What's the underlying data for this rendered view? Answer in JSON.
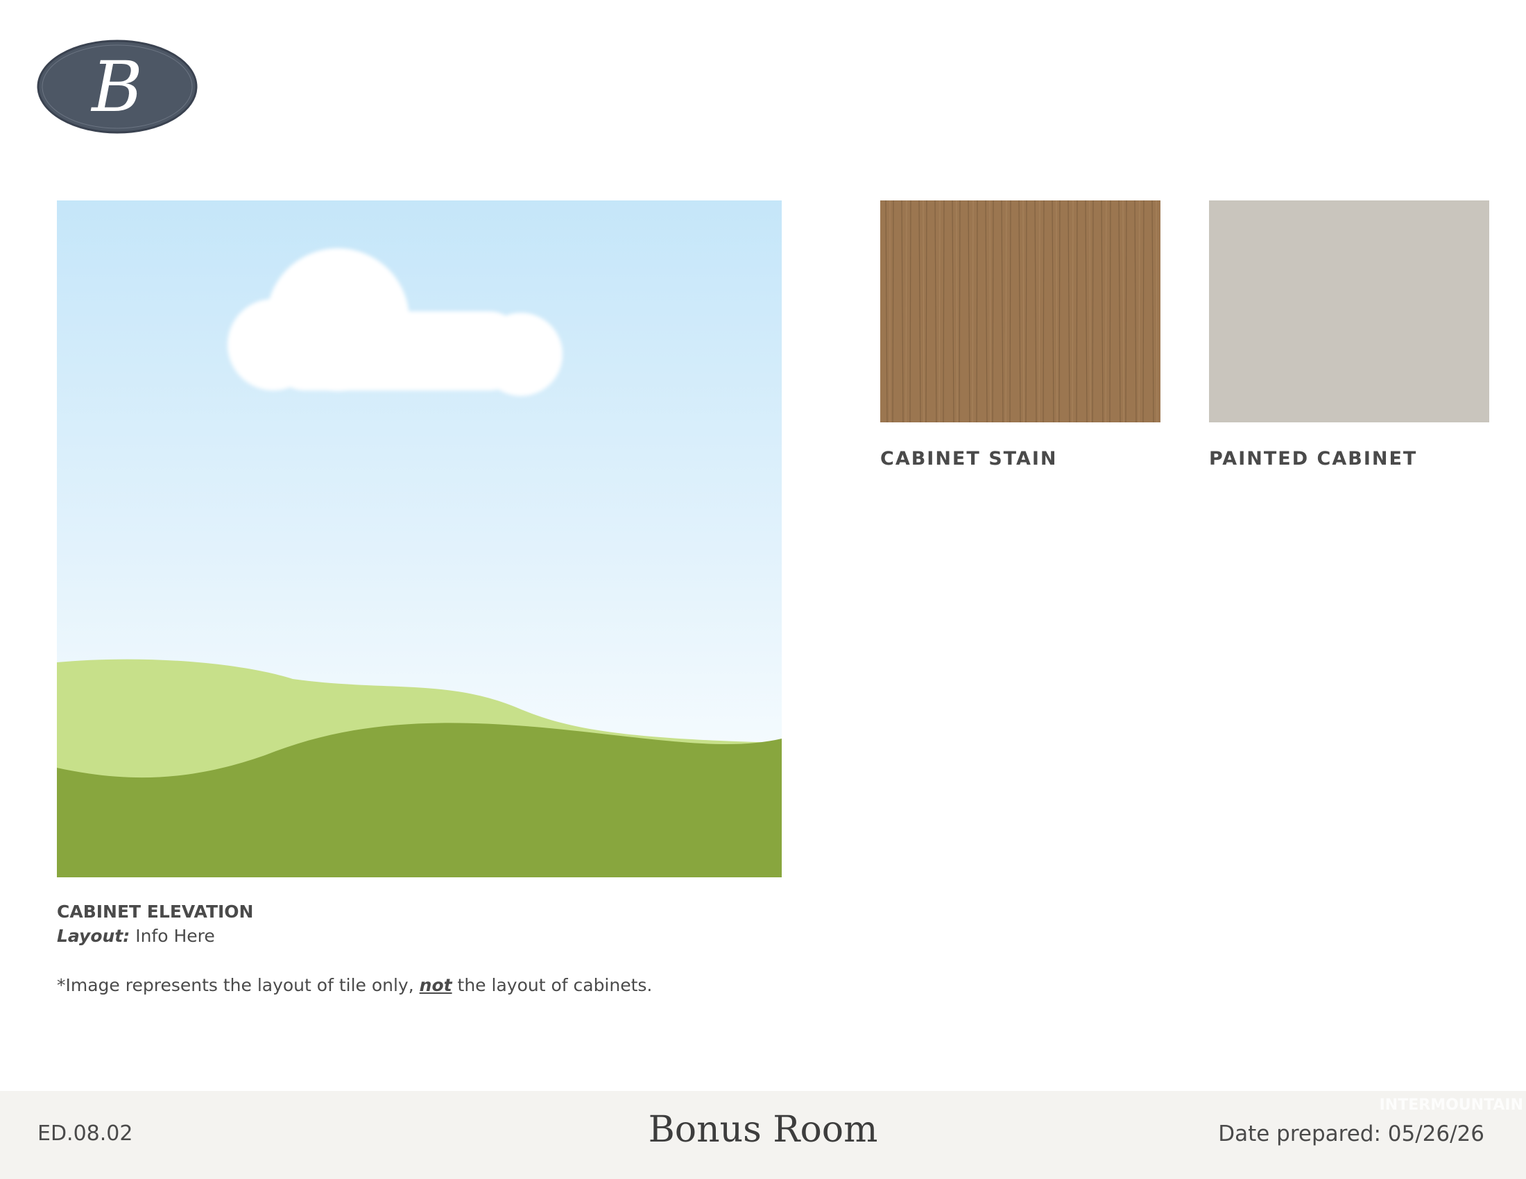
{
  "logo": {
    "letter": "B",
    "fill": "#4d5765"
  },
  "elevation": {
    "placeholder_icon": "landscape-placeholder-icon",
    "title": "CABINET ELEVATION",
    "layout_label": "Layout:",
    "layout_value": "Info Here",
    "note_before": "*Image represents the layout of tile only,",
    "note_emphasis": "not",
    "note_after": "the layout of cabinets."
  },
  "swatches": [
    {
      "label": "CABINET STAIN",
      "color": "#9b7650"
    },
    {
      "label": "PAINTED CABINET",
      "color": "#c9c5bd"
    }
  ],
  "footer": {
    "code": "ED.08.02",
    "title": "Bonus Room",
    "date_label": "Date prepared:",
    "date_value": "05/26/26",
    "watermark": "INTERMOUNTAIN"
  }
}
